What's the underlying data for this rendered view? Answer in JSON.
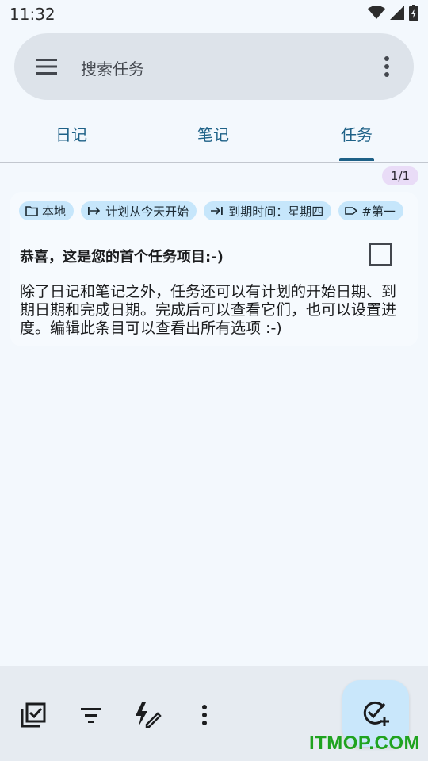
{
  "status_bar": {
    "time": "11:32"
  },
  "search": {
    "placeholder": "搜索任务"
  },
  "tabs": [
    {
      "label": "日记"
    },
    {
      "label": "笔记"
    },
    {
      "label": "任务",
      "selected": true
    }
  ],
  "list": {
    "counter": "1/1"
  },
  "task": {
    "chips": [
      {
        "icon": "folder-icon",
        "label": "本地"
      },
      {
        "icon": "start-date-icon",
        "label": "计划从今天开始"
      },
      {
        "icon": "due-date-icon",
        "label": "到期时间：星期四"
      },
      {
        "icon": "tag-icon",
        "label": "#第一"
      }
    ],
    "title": "恭喜，这是您的首个任务项目:-)",
    "description": "除了日记和笔记之外，任务还可以有计划的开始日期、到期日期和完成日期。完成后可以查看它们，也可以设置进度。编辑此条目可以查看出所有选项 :-)",
    "checked": false
  },
  "watermark": "ITMOP.COM",
  "colors": {
    "accent": "#1e6187",
    "chip": "#c6e6fb",
    "fab": "#c9e7fb",
    "background": "#f3f8fd"
  }
}
